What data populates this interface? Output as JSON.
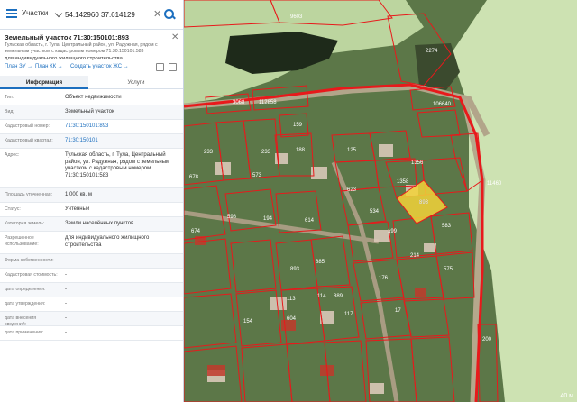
{
  "search": {
    "layer": "Участки",
    "query": "54.142960 37.614129"
  },
  "card": {
    "title": "Земельный участок 71:30:150101:893",
    "address_sub": "Тульская область, г. Тула, Центральный район, ул. Радужная, рядом с земельным участком с кадастровым номером 71:30:150101:583",
    "purpose_line": "для индивидуального жилищного строительства",
    "links": {
      "plan_zu": "План ЗУ →",
      "plan_kk": "План КК →",
      "create_zs": "Создать участок ЖС →"
    }
  },
  "tabs": {
    "info": "Информация",
    "services": "Услуги"
  },
  "props": [
    {
      "k": "Тип:",
      "v": "Объект недвижимости"
    },
    {
      "k": "Вид:",
      "v": "Земельный участок"
    },
    {
      "k": "Кадастровый номер:",
      "v": "71:30:150101:893"
    },
    {
      "k": "Кадастровый квартал:",
      "v": "71:30:150101"
    },
    {
      "k": "Адрес:",
      "v": "Тульская область, г. Тула, Центральный район, ул. Радужная, рядом с земельным участком с кадастровым номером 71:30:150101:583"
    },
    {
      "k": "Площадь уточненная:",
      "v": "1 000 кв. м"
    },
    {
      "k": "Статус:",
      "v": "Учтенный"
    },
    {
      "k": "Категория земель:",
      "v": "Земли населённых пунктов"
    },
    {
      "k": "Разрешенное использование:",
      "v": "для индивидуального жилищного строительства"
    },
    {
      "k": "Форма собственности:",
      "v": "-"
    },
    {
      "k": "Кадастровая стоимость:",
      "v": "-"
    },
    {
      "k": "дата определения:",
      "v": "-"
    },
    {
      "k": "дата утверждения:",
      "v": "-"
    },
    {
      "k": "дата внесения сведений:",
      "v": "-"
    },
    {
      "k": "дата применения:",
      "v": "-"
    }
  ],
  "map": {
    "parcel_labels": [
      "9603",
      "3068",
      "112858",
      "106640",
      "2274",
      "159",
      "233",
      "233",
      "678",
      "573",
      "188",
      "125",
      "1356",
      "1358",
      "623",
      "893",
      "534",
      "199",
      "583",
      "11460",
      "674",
      "614",
      "598",
      "194",
      "893",
      "885",
      "889",
      "114",
      "117",
      "113",
      "604",
      "214",
      "575",
      "176",
      "154",
      "17",
      "200"
    ],
    "scale": "40 м"
  }
}
